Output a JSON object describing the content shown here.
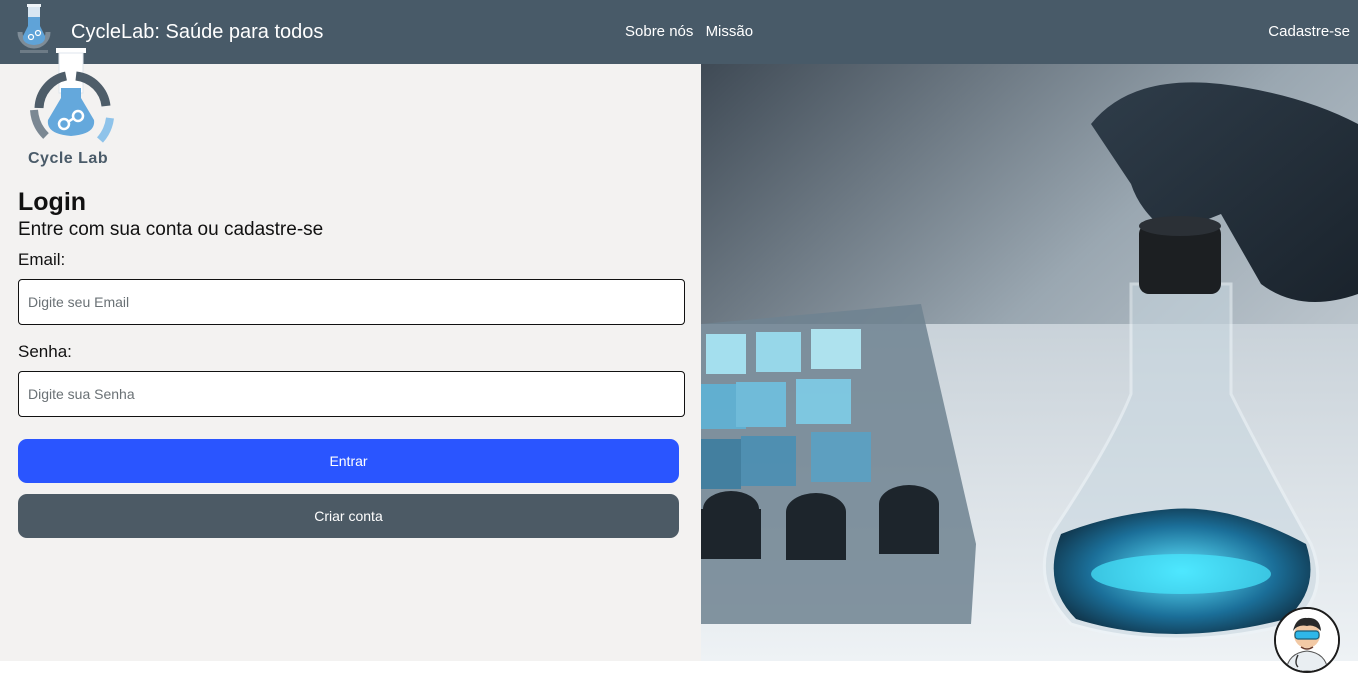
{
  "navbar": {
    "title": "CycleLab: Saúde para todos",
    "links": [
      "Sobre nós",
      "Missão"
    ],
    "signup": "Cadastre-se"
  },
  "brand": {
    "name": "Cycle Lab"
  },
  "login": {
    "title": "Login",
    "subtitle": "Entre com sua conta ou cadastre-se",
    "email_label": "Email:",
    "email_placeholder": "Digite seu Email",
    "password_label": "Senha:",
    "password_placeholder": "Digite sua Senha",
    "enter_button": "Entrar",
    "create_button": "Criar conta"
  },
  "hero_image": {
    "icon": "lab-flask-photo-icon"
  },
  "chat": {
    "icon": "doctor-avatar-icon"
  },
  "colors": {
    "navbar": "#485a68",
    "panel": "#f3f2f1",
    "primary": "#2a55ff",
    "secondary": "#4c5a65"
  }
}
